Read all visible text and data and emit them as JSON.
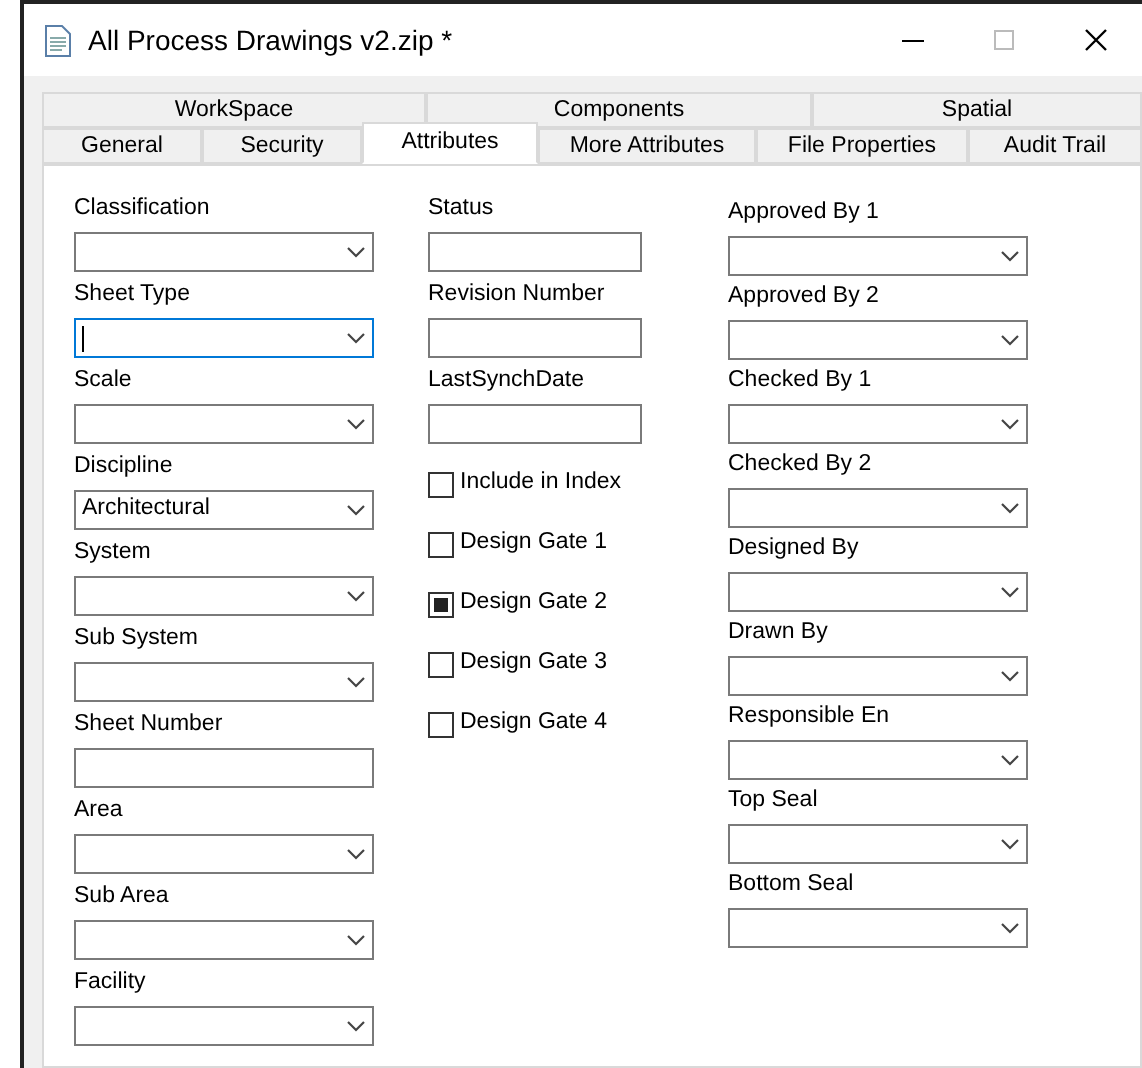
{
  "window": {
    "title": "All Process Drawings v2.zip *"
  },
  "tab_rows": [
    [
      {
        "label": "WorkSpace",
        "selected": false
      },
      {
        "label": "Components",
        "selected": false
      },
      {
        "label": "Spatial",
        "selected": false
      }
    ],
    [
      {
        "label": "General",
        "selected": false
      },
      {
        "label": "Security",
        "selected": false
      },
      {
        "label": "Attributes",
        "selected": true
      },
      {
        "label": "More Attributes",
        "selected": false
      },
      {
        "label": "File Properties",
        "selected": false
      },
      {
        "label": "Audit Trail",
        "selected": false
      }
    ]
  ],
  "columns": [
    [
      {
        "kind": "dropdown",
        "label": "Classification"
      },
      {
        "kind": "dropdown",
        "label": "Sheet Type",
        "focused": true
      },
      {
        "kind": "dropdown",
        "label": "Scale"
      },
      {
        "kind": "dropdown",
        "label": "Discipline",
        "value": "Architectural"
      },
      {
        "kind": "dropdown",
        "label": "System"
      },
      {
        "kind": "dropdown",
        "label": "Sub System"
      },
      {
        "kind": "text",
        "label": "Sheet Number"
      },
      {
        "kind": "dropdown",
        "label": "Area"
      },
      {
        "kind": "dropdown",
        "label": "Sub Area"
      },
      {
        "kind": "dropdown",
        "label": "Facility"
      }
    ],
    [
      {
        "kind": "text",
        "label": "Status"
      },
      {
        "kind": "text",
        "label": "Revision Number"
      },
      {
        "kind": "text",
        "label": "LastSynchDate"
      },
      {
        "kind": "checkbox",
        "label": "Include in Index",
        "checked": false
      },
      {
        "kind": "checkbox",
        "label": "Design Gate 1",
        "checked": false
      },
      {
        "kind": "checkbox",
        "label": "Design Gate 2",
        "checked": true
      },
      {
        "kind": "checkbox",
        "label": "Design Gate 3",
        "checked": false
      },
      {
        "kind": "checkbox",
        "label": "Design Gate 4",
        "checked": false
      }
    ],
    [
      {
        "kind": "dropdown",
        "label": "Approved By 1"
      },
      {
        "kind": "dropdown",
        "label": "Approved By 2"
      },
      {
        "kind": "dropdown",
        "label": "Checked By 1"
      },
      {
        "kind": "dropdown",
        "label": "Checked By 2"
      },
      {
        "kind": "dropdown",
        "label": "Designed By"
      },
      {
        "kind": "dropdown",
        "label": "Drawn By"
      },
      {
        "kind": "dropdown",
        "label": "Responsible En"
      },
      {
        "kind": "dropdown",
        "label": "Top Seal"
      },
      {
        "kind": "dropdown",
        "label": "Bottom Seal"
      }
    ]
  ]
}
